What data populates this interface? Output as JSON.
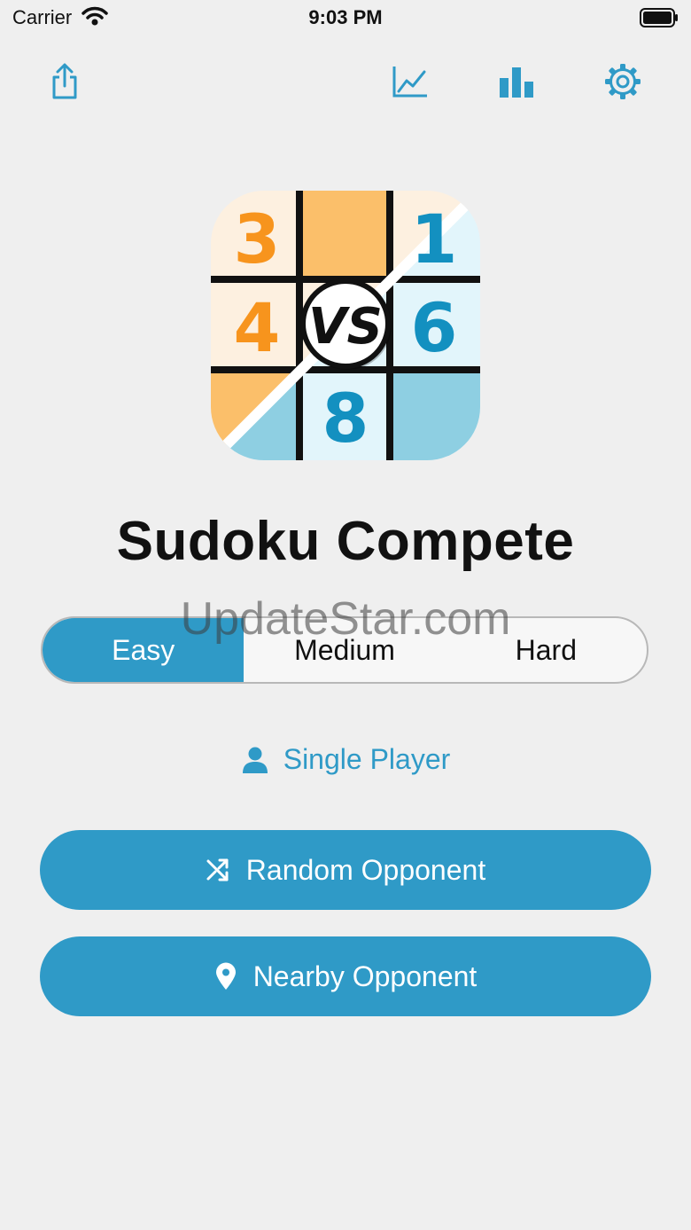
{
  "status_bar": {
    "carrier": "Carrier",
    "time": "9:03 PM"
  },
  "toolbar": {
    "icons": [
      "share-icon",
      "line-chart-icon",
      "bar-chart-icon",
      "gear-icon"
    ]
  },
  "app_icon": {
    "digits": [
      "3",
      "1",
      "4",
      "6",
      "8"
    ],
    "vs_label": "VS",
    "colors": {
      "orange": "#f7941d",
      "blue": "#1390c0"
    }
  },
  "title": "Sudoku Compete",
  "watermark": "UpdateStar.com",
  "difficulty": {
    "options": [
      "Easy",
      "Medium",
      "Hard"
    ],
    "selected": "Easy"
  },
  "single_player": {
    "label": "Single Player",
    "icon": "person-icon"
  },
  "buttons": {
    "random": {
      "label": "Random Opponent",
      "icon": "shuffle-icon"
    },
    "nearby": {
      "label": "Nearby Opponent",
      "icon": "location-pin-icon"
    }
  },
  "colors": {
    "accent": "#2f9ac7",
    "background": "#efefef"
  }
}
